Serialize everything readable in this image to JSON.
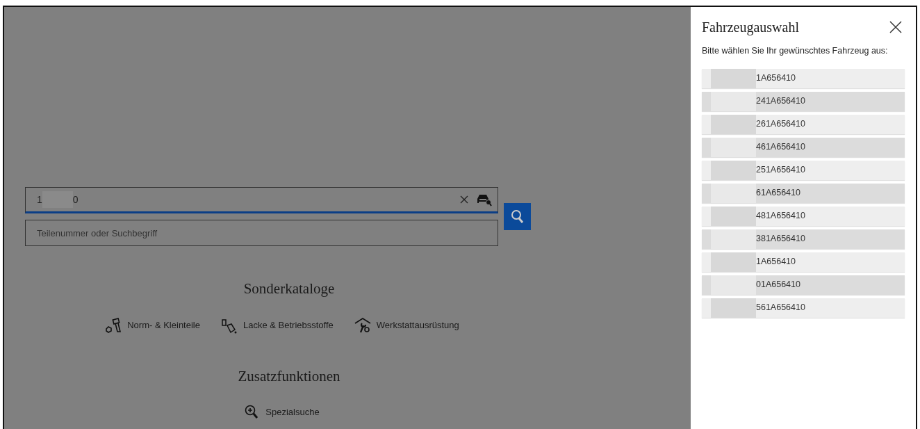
{
  "search": {
    "vehicle_field": {
      "value_parts": [
        "1",
        "0"
      ]
    },
    "part_field": {
      "placeholder": "Teilenummer oder Suchbegriff"
    }
  },
  "special_catalogs": {
    "title": "Sonderkataloge",
    "items": [
      {
        "label": "Norm- & Kleinteile",
        "kind": "bolts"
      },
      {
        "label": "Lacke & Betriebsstoffe",
        "kind": "paint"
      },
      {
        "label": "Werkstattausrüstung",
        "kind": "workshop"
      }
    ]
  },
  "extra_functions": {
    "title": "Zusatzfunktionen",
    "items": [
      {
        "label": "Spezialsuche",
        "kind": "zoom"
      }
    ]
  },
  "vehicle_panel": {
    "title": "Fahrzeugauswahl",
    "prompt": "Bitte wählen Sie Ihr gewünschtes Fahrzeug aus:",
    "vehicles": [
      {
        "label": "1A656410"
      },
      {
        "label": "241A656410"
      },
      {
        "label": "261A656410"
      },
      {
        "label": "461A656410"
      },
      {
        "label": "251A656410"
      },
      {
        "label": "61A656410"
      },
      {
        "label": "481A656410"
      },
      {
        "label": "381A656410"
      },
      {
        "label": "1A656410"
      },
      {
        "label": "01A656410"
      },
      {
        "label": "561A656410"
      }
    ]
  }
}
